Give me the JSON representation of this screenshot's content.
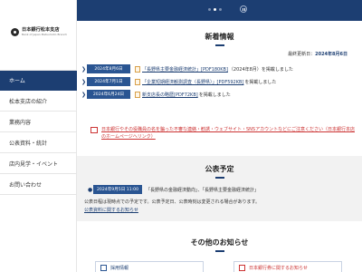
{
  "logo": {
    "main": "日本銀行松本支店",
    "sub": "Bank of Japan Matsumoto Branch"
  },
  "nav": [
    {
      "label": "ホーム",
      "active": true
    },
    {
      "label": "松本支店の紹介",
      "active": false
    },
    {
      "label": "業務内容",
      "active": false
    },
    {
      "label": "公表資料・統計",
      "active": false
    },
    {
      "label": "店内見学・イベント",
      "active": false
    },
    {
      "label": "お問い合わせ",
      "active": false
    }
  ],
  "hero": {
    "slides": 3,
    "current": 1
  },
  "news": {
    "title": "新着情報",
    "updated_label": "最終更新日：",
    "updated_value": "2024年8月6日",
    "items": [
      {
        "date": "2024年8月6日",
        "link": "「長野県主要金融経済統計」[PDF180KB]",
        "suffix": "（2024年8月）を掲載しました"
      },
      {
        "date": "2024年7月1日",
        "link": "「企業短期経済観測調査（長野県）」[PDF592KB]",
        "suffix": "を掲載しました"
      },
      {
        "date": "2024年6月24日",
        "link": "新支店長の略歴[PDF72KB]",
        "suffix": "を掲載しました"
      }
    ]
  },
  "warning": {
    "text": "日本銀行やその役職員の名を騙った不審な連絡・勧誘・ウェブサイト・SNSアカウントなどにご注意ください（日本銀行本店のホームページへリンク）"
  },
  "plans": {
    "title": "公表予定",
    "date": "2024年9月5日 11:00",
    "item": "「長野県の金融経済動向」、「長野県主要金融経済統計」",
    "note": "公表日程は現時点での予定です。公表予定日、公表時刻は変更される場合があります。",
    "link": "公表資料に関するお知らせ"
  },
  "other": {
    "title": "その他のお知らせ",
    "card_left": "採用情報",
    "card_right": "日本銀行券に関するお知らせ"
  }
}
